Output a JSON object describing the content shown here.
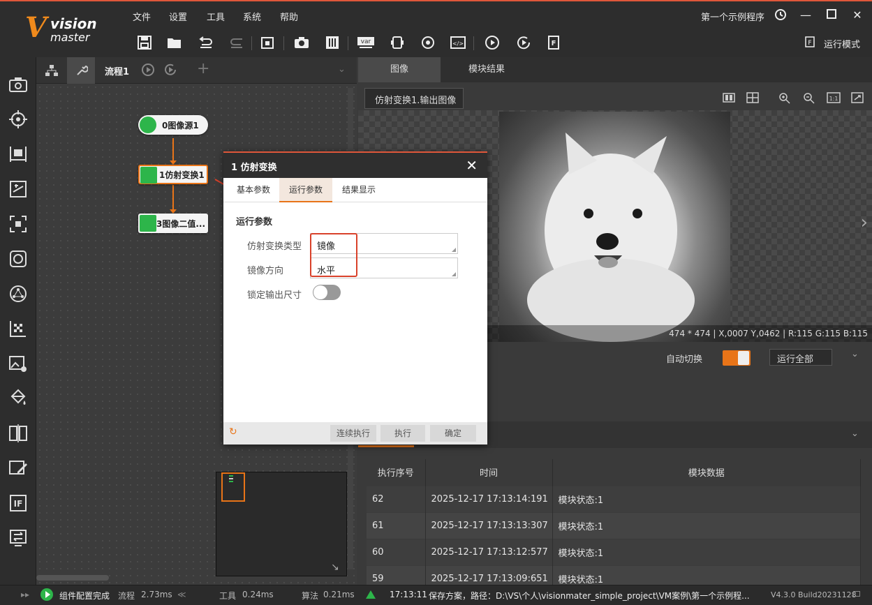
{
  "logo": {
    "v": "V",
    "vision": "vision",
    "master": "master"
  },
  "menu": [
    "文件",
    "设置",
    "工具",
    "系统",
    "帮助"
  ],
  "window": {
    "solution_name": "第一个示例程序",
    "run_mode_label": "运行模式"
  },
  "toolbar_icons": [
    "save-icon",
    "open-folder-icon",
    "undo-icon",
    "redo-icon",
    "lock-icon",
    "camera-icon",
    "settings-sliders-icon",
    "var-icon",
    "communication-icon",
    "global-trigger-icon",
    "script-icon",
    "run-once-icon",
    "run-loop-icon",
    "report-icon"
  ],
  "left_tools": [
    "camera-tool-icon",
    "locate-tool-icon",
    "measure-tool-icon",
    "calc-tool-icon",
    "recognize-tool-icon",
    "defect-tool-icon",
    "ai-tool-icon",
    "calibrate-tool-icon",
    "image-process-tool-icon",
    "color-tool-icon",
    "compare-tool-icon",
    "draw-tool-icon",
    "logic-if-icon",
    "communication-tool-icon"
  ],
  "flow": {
    "tab_label": "流程1",
    "nodes": [
      {
        "label": "0图像源1"
      },
      {
        "label": "1仿射变换1"
      },
      {
        "label": "3图像二值..."
      }
    ]
  },
  "dialog": {
    "title": "1 仿射变换",
    "tabs": [
      "基本参数",
      "运行参数",
      "结果显示"
    ],
    "active_tab": 1,
    "section_title": "运行参数",
    "fields": [
      {
        "label": "仿射变换类型",
        "value": "镜像"
      },
      {
        "label": "镜像方向",
        "value": "水平"
      },
      {
        "label": "锁定输出尺寸",
        "value": "off"
      }
    ],
    "buttons": {
      "continuous": "连续执行",
      "execute": "执行",
      "confirm": "确定"
    }
  },
  "image_pane": {
    "tabs": [
      "图像",
      "模块结果"
    ],
    "active_tab": 0,
    "image_select": "仿射变换1.输出图像",
    "pixel_info": "474 * 474  |  X,0007  Y,0462  |  R:115  G:115  B:115",
    "auto_switch_label": "自动切换",
    "run_all_label": "运行全部"
  },
  "history": {
    "columns": [
      "执行序号",
      "时间",
      "模块数据"
    ],
    "rows": [
      {
        "seq": "62",
        "time": "2025-12-17 17:13:14:191",
        "data": "模块状态:1"
      },
      {
        "seq": "61",
        "time": "2025-12-17 17:13:13:307",
        "data": "模块状态:1"
      },
      {
        "seq": "60",
        "time": "2025-12-17 17:13:12:577",
        "data": "模块状态:1"
      },
      {
        "seq": "59",
        "time": "2025-12-17 17:13:09:651",
        "data": "模块状态:1"
      }
    ]
  },
  "status": {
    "config_done": "组件配置完成",
    "flow_label": "流程",
    "flow_time": "2.73ms",
    "tool_label": "工具",
    "tool_time": "0.24ms",
    "algo_label": "算法",
    "algo_time": "0.21ms",
    "log_time": "17:13:11",
    "log_msg": "保存方案，路径：D:\\VS\\个人\\visionmater_simple_project\\VM案例\\第一个示例程...",
    "version": "V4.3.0 Build20231128"
  },
  "colors": {
    "accent": "#e87418",
    "title_bar_line": "#e0573a",
    "node_green": "#2db54a",
    "annotation_red": "#d9412a"
  }
}
